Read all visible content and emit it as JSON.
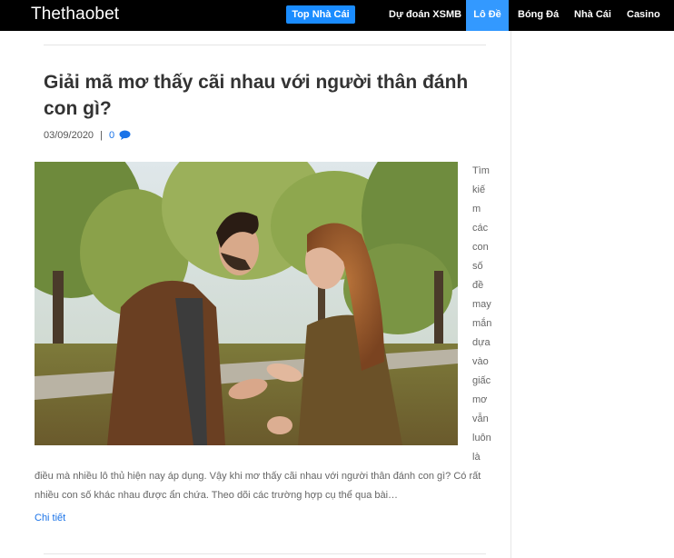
{
  "header": {
    "brand": "Thethaobet",
    "top_button": "Top Nhà Cái",
    "nav": [
      "Dự đoán XSMB",
      "Lô Đề",
      "Bóng Đá",
      "Nhà Cái",
      "Casino"
    ],
    "active_nav": "Lô Đề"
  },
  "article": {
    "title": "Giải mã mơ thấy cãi nhau với người thân đánh con gì?",
    "date": "03/09/2020",
    "separator": "|",
    "comment_count": "0",
    "narrow_words": [
      "Tìm",
      "kiế",
      "m",
      "các",
      "con",
      "số",
      "đề",
      "may",
      "mắn",
      "dựa",
      "vào",
      "giấc",
      "mơ",
      "vẫn",
      "luôn",
      "là"
    ],
    "excerpt": "điều mà nhiều lô thủ hiện nay áp dụng. Vậy khi mơ thấy cãi nhau với người thân đánh con gì? Có rất nhiều con số khác nhau được ẩn chứa. Theo dõi các trường hợp cụ thể qua bài…",
    "read_more": "Chi tiết"
  },
  "colors": {
    "navbar": "#000000",
    "accent": "#1a8cff",
    "active_nav": "#3399ff",
    "link": "#1a73e8"
  }
}
